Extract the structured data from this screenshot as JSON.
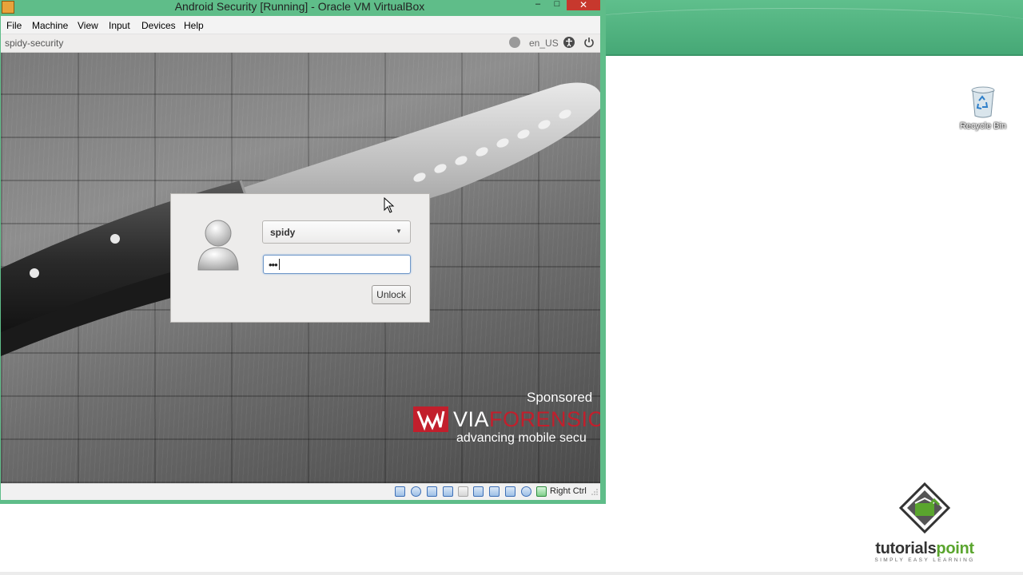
{
  "window": {
    "title": "Android Security [Running] - Oracle VM VirtualBox",
    "controls": {
      "minimize": "–",
      "maximize": "□",
      "close": "✕"
    }
  },
  "menubar": {
    "items": [
      "File",
      "Machine",
      "View",
      "Input",
      "Devices",
      "Help"
    ]
  },
  "guest_topbar": {
    "hostname": "spidy-security",
    "language": "en_US",
    "icons": [
      "network-icon",
      "accessibility-icon",
      "power-icon"
    ]
  },
  "unlock_dialog": {
    "username": "spidy",
    "password_mask": "•••",
    "unlock_label": "Unlock"
  },
  "wallpaper": {
    "sponsored": "Sponsored",
    "brand_white": "VIA",
    "brand_red": "FORENSIC",
    "tagline": "advancing mobile secu"
  },
  "statusbar": {
    "host_key": "Right Ctrl",
    "icons": [
      "hard-disk-icon",
      "optical-drive-icon",
      "usb-icon",
      "shared-folders-icon",
      "folder-icon",
      "display-icon",
      "network-adapter-icon",
      "video-capture-icon",
      "mouse-integration-icon",
      "host-key-indicator-icon"
    ]
  },
  "desktop": {
    "recycle_bin_label": "Recycle Bin",
    "watermark": {
      "part1": "tutorials",
      "part2": "point",
      "tagline": "SIMPLY EASY LEARNING"
    }
  },
  "colors": {
    "vbox_frame": "#5fbd89",
    "close_button": "#c21f2c",
    "desktop_header": "#4aab79",
    "brand_red": "#c21f2c",
    "tp_green": "#5aa52e"
  }
}
